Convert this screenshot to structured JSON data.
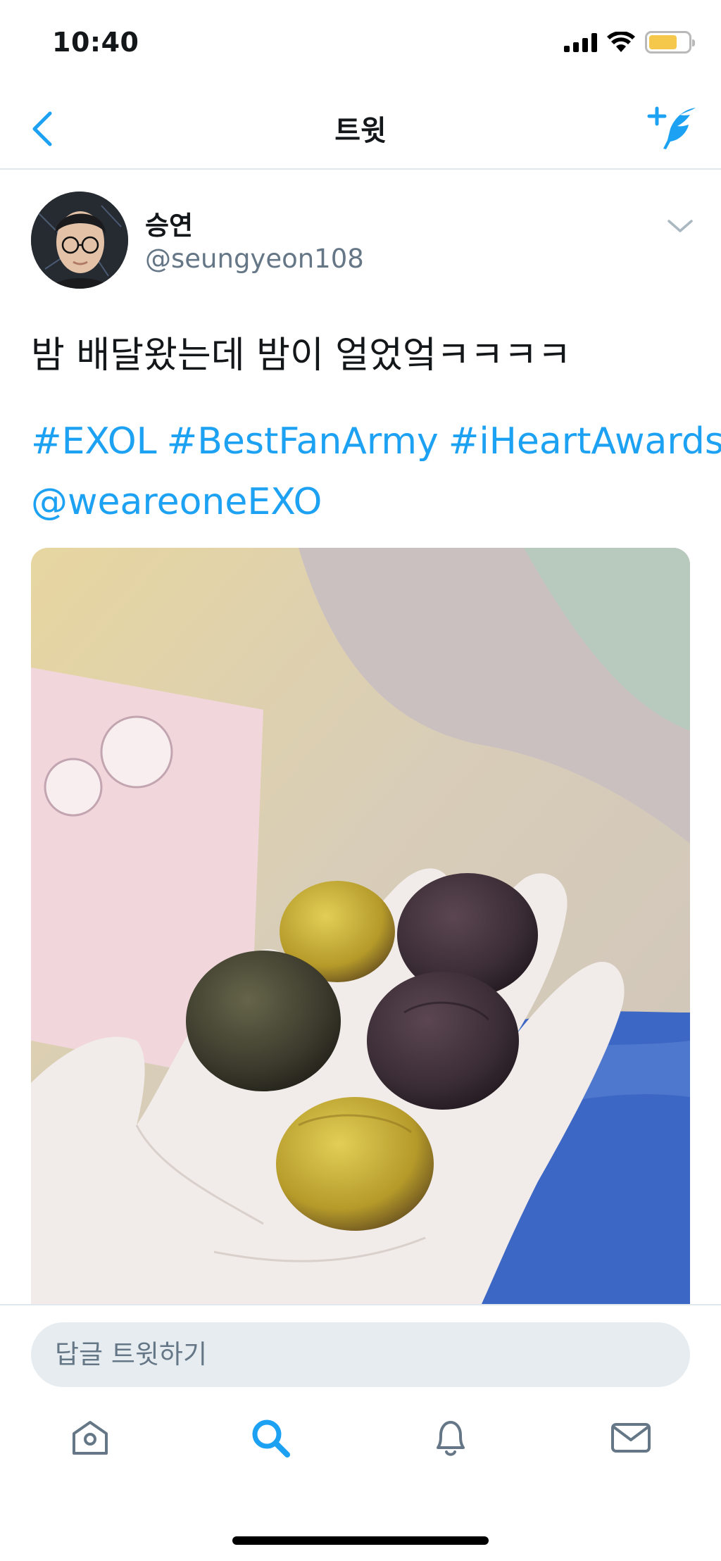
{
  "status_bar": {
    "time": "10:40",
    "icons": [
      "signal-icon",
      "wifi-icon",
      "battery-icon"
    ],
    "battery_color": "#f5c84b"
  },
  "nav": {
    "title": "트윗",
    "back_icon": "chevron-left-icon",
    "compose_icon": "compose-tweet-icon",
    "accent": "#1da1f2"
  },
  "tweet": {
    "user_name": "승연",
    "user_handle": "@seungyeon108",
    "text": "밤 배달왔는데 밤이 얼었엌ㅋㅋㅋㅋ",
    "hashtags": [
      "#EXOL",
      "#BestFanArmy",
      "#iHeartAwards"
    ],
    "mention": "@weareoneEXO",
    "photo_description_icon": "photo-chestnuts-in-hand"
  },
  "reply": {
    "placeholder": "답글 트윗하기"
  },
  "tabs": [
    {
      "name": "home",
      "icon": "home-icon",
      "active": false
    },
    {
      "name": "search",
      "icon": "search-icon",
      "active": true
    },
    {
      "name": "notifications",
      "icon": "bell-icon",
      "active": false
    },
    {
      "name": "messages",
      "icon": "mail-icon",
      "active": false
    }
  ]
}
